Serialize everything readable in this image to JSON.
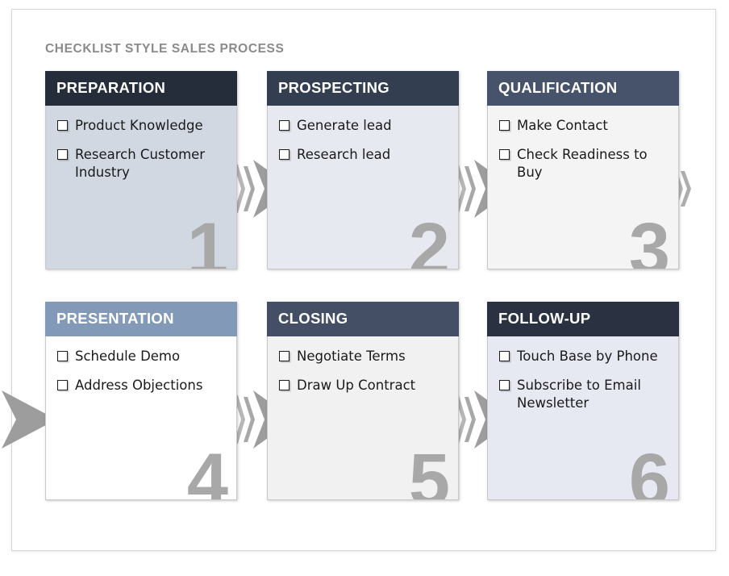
{
  "diagram": {
    "title": "CHECKLIST STYLE SALES PROCESS",
    "title_color": "#8a8a8a",
    "arrow_color": "#9d9d9d"
  },
  "cards": [
    {
      "id": "card-1",
      "number": "1",
      "header": "PREPARATION",
      "header_color": "#262d3a",
      "body_color": "#d2d8e2",
      "tasks": [
        {
          "label": "Product Knowledge",
          "checked": false
        },
        {
          "label": "Research Customer Industry",
          "checked": false
        }
      ]
    },
    {
      "id": "card-2",
      "number": "2",
      "header": "PROSPECTING",
      "header_color": "#333e51",
      "body_color": "#e7e9f1",
      "tasks": [
        {
          "label": "Generate lead",
          "checked": false
        },
        {
          "label": "Research lead",
          "checked": false
        }
      ]
    },
    {
      "id": "card-3",
      "number": "3",
      "header": "QUALIFICATION",
      "header_color": "#46536b",
      "body_color": "#f4f4f4",
      "tasks": [
        {
          "label": "Make Contact",
          "checked": false
        },
        {
          "label": "Check Readiness to Buy",
          "checked": false
        }
      ]
    },
    {
      "id": "card-4",
      "number": "4",
      "header": "PRESENTATION",
      "header_color": "#829ab8",
      "body_color": "#ffffff",
      "tasks": [
        {
          "label": "Schedule Demo",
          "checked": false
        },
        {
          "label": "Address Objections",
          "checked": false
        }
      ]
    },
    {
      "id": "card-5",
      "number": "5",
      "header": "CLOSING",
      "header_color": "#444f66",
      "body_color": "#f1f1f1",
      "tasks": [
        {
          "label": "Negotiate Terms",
          "checked": false
        },
        {
          "label": "Draw Up Contract",
          "checked": false
        }
      ]
    },
    {
      "id": "card-6",
      "number": "6",
      "header": "FOLLOW-UP",
      "header_color": "#2a3242",
      "body_color": "#e6e9f2",
      "tasks": [
        {
          "label": "Touch Base by Phone",
          "checked": false
        },
        {
          "label": "Subscribe to Email Newsletter",
          "checked": false
        }
      ]
    }
  ],
  "connectors": [
    {
      "id": "connector-1-2",
      "kind": "arrow-with-tail",
      "from": "card-1",
      "to": "card-2"
    },
    {
      "id": "connector-2-3",
      "kind": "arrow-with-tail",
      "from": "card-2",
      "to": "card-3"
    },
    {
      "id": "connector-3-end",
      "kind": "tail-only",
      "from": "card-3",
      "to": "card-4"
    },
    {
      "id": "connector-start-4",
      "kind": "arrow-only",
      "from": "card-3",
      "to": "card-4"
    },
    {
      "id": "connector-4-5",
      "kind": "arrow-with-tail",
      "from": "card-4",
      "to": "card-5"
    },
    {
      "id": "connector-5-6",
      "kind": "arrow-with-tail",
      "from": "card-5",
      "to": "card-6"
    }
  ]
}
